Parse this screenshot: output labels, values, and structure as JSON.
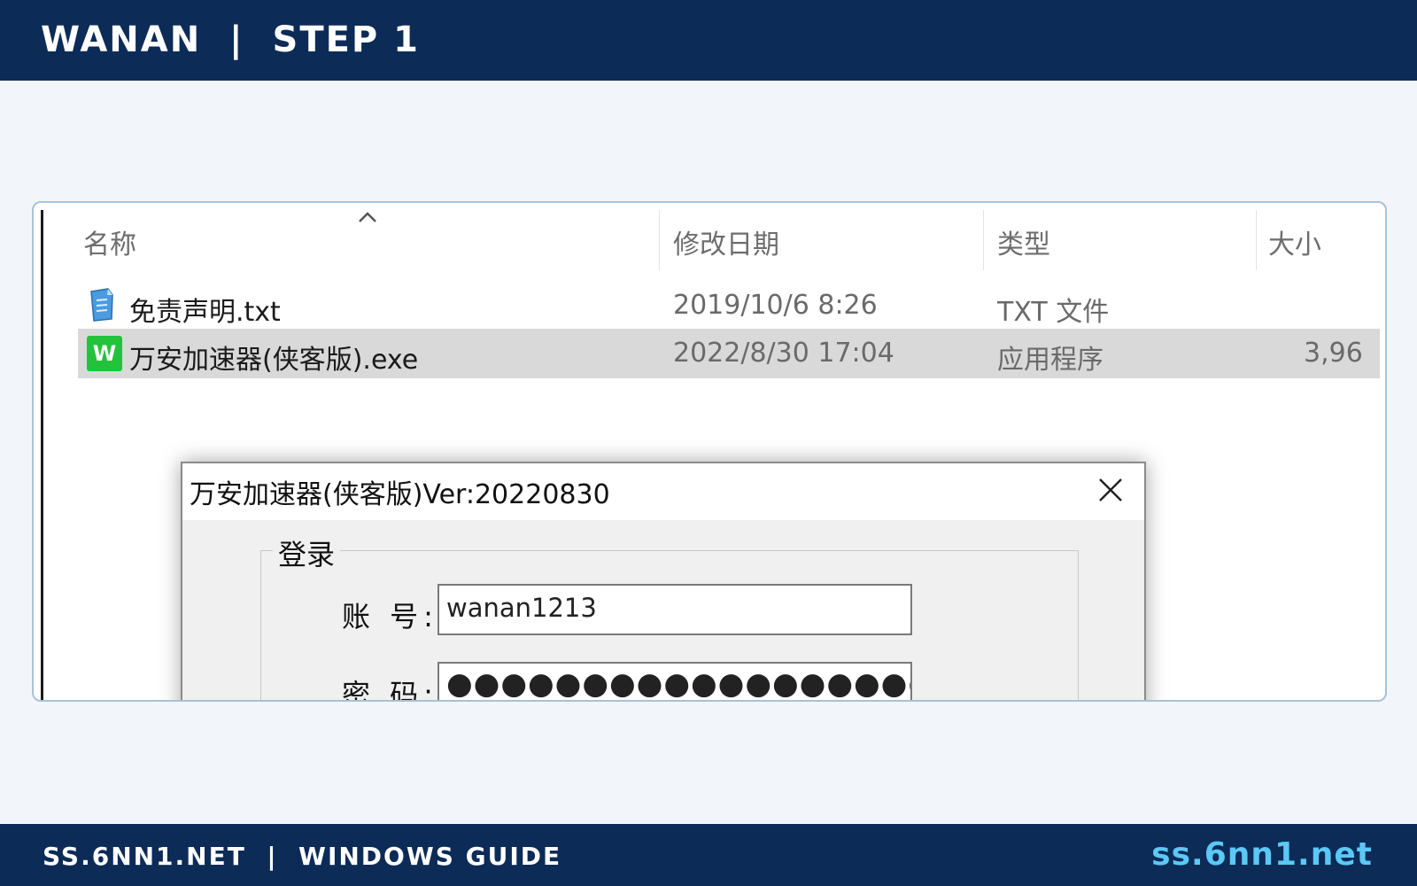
{
  "header": {
    "title": "WANAN  |  STEP 1"
  },
  "explorer": {
    "columns": [
      "名称",
      "修改日期",
      "类型",
      "大小"
    ],
    "rows": [
      {
        "name": "免责声明.txt",
        "date": "2019/10/6 8:26",
        "type": "TXT 文件",
        "size": "",
        "icon": "text-file-icon"
      },
      {
        "name": "万安加速器(侠客版).exe",
        "date": "2022/8/30 17:04",
        "type": "应用程序",
        "size": "3,96",
        "icon": "app-w-icon",
        "selected": true
      }
    ]
  },
  "dialog": {
    "title": "万安加速器(侠客版)Ver:20220830",
    "group_label": "登录",
    "account_label": "账 号:",
    "account_value": "wanan1213",
    "password_label": "密 码:",
    "password_value": "●●●●●●●●●●●●●●●●●●●●●●●●●●●●●●●●●●●",
    "exe_icon_letter": "W"
  },
  "footer": {
    "left": "SS.6NN1.NET  |  WINDOWS GUIDE",
    "right": "ss.6nn1.net"
  },
  "colors": {
    "bar": "#0d2b57",
    "accent": "#5bc8f5",
    "selected_row": "#d9d9d9",
    "exe_icon": "#22c33a"
  }
}
